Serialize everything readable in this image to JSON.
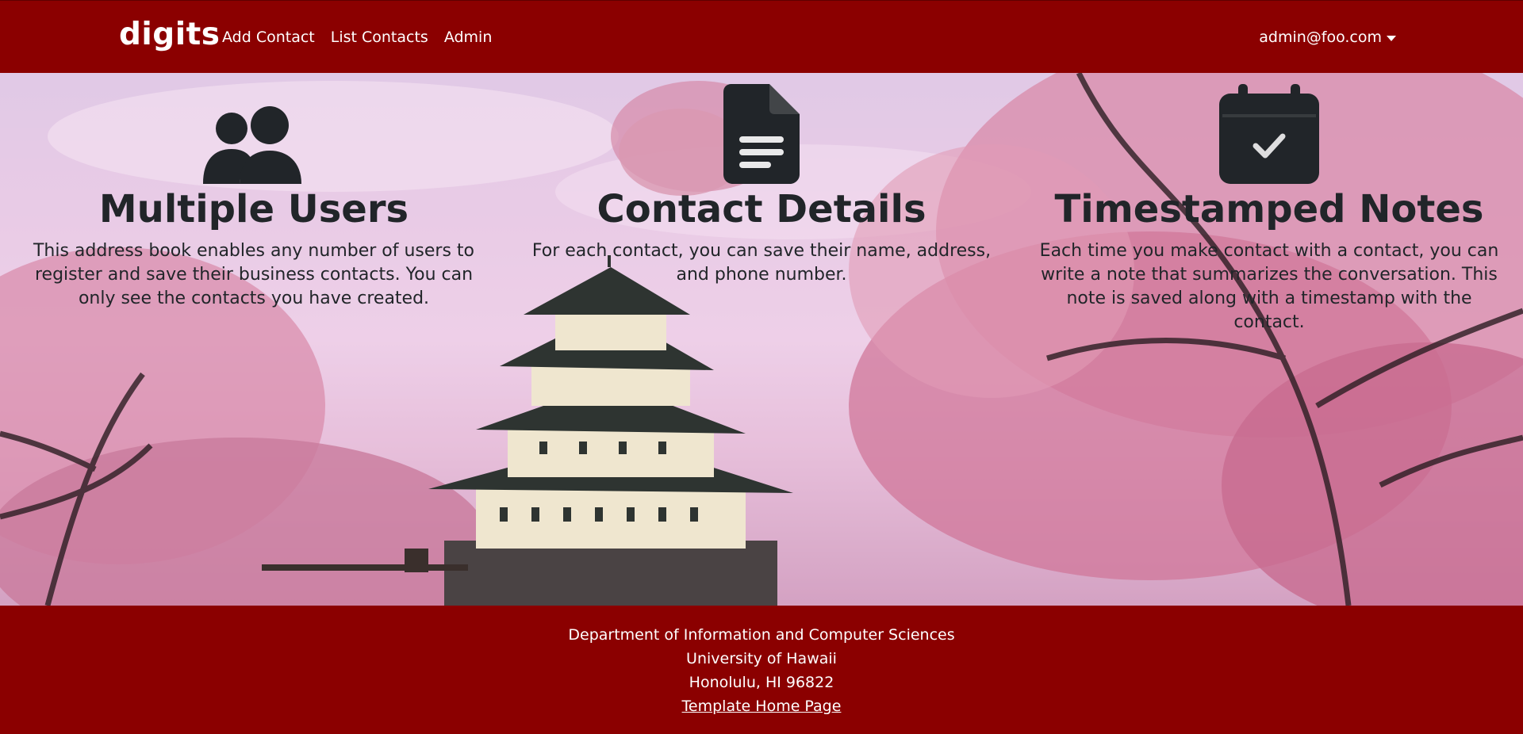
{
  "navbar": {
    "brand": "digits",
    "links": [
      "Add Contact",
      "List Contacts",
      "Admin"
    ],
    "user": "admin@foo.com"
  },
  "features": [
    {
      "icon": "users-icon",
      "title": "Multiple Users",
      "text": "This address book enables any number of users to register and save their business contacts. You can only see the contacts you have created."
    },
    {
      "icon": "file-text-icon",
      "title": "Contact Details",
      "text": "For each contact, you can save their name, address, and phone number."
    },
    {
      "icon": "calendar-check-icon",
      "title": "Timestamped Notes",
      "text": "Each time you make contact with a contact, you can write a note that summarizes the conversation. This note is saved along with a timestamp with the contact."
    }
  ],
  "footer": {
    "line1": "Department of Information and Computer Sciences",
    "line2": "University of Hawaii",
    "line3": "Honolulu, HI 96822",
    "link": "Template Home Page"
  },
  "colors": {
    "brand_red": "#8b0000",
    "text_dark": "#212529",
    "white": "#ffffff"
  }
}
